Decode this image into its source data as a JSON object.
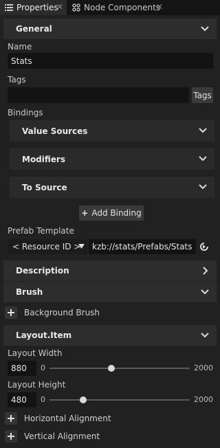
{
  "tabs": [
    {
      "label": "Properties",
      "active": true
    },
    {
      "label": "Node Components",
      "active": false
    }
  ],
  "general": {
    "title": "General",
    "name_label": "Name",
    "name_value": "Stats",
    "tags_label": "Tags",
    "tags_value": "",
    "tags_button": "Tags",
    "bindings_label": "Bindings",
    "bindings": [
      {
        "label": "Value Sources"
      },
      {
        "label": "Modifiers"
      },
      {
        "label": "To Source"
      }
    ],
    "add_binding": "Add Binding",
    "prefab_label": "Prefab Template",
    "resource_select": "< Resource ID >",
    "prefab_value": "kzb://stats/Prefabs/Stats"
  },
  "description": {
    "title": "Description"
  },
  "brush": {
    "title": "Brush",
    "background_brush": "Background Brush"
  },
  "layout_item": {
    "title": "Layout.Item",
    "width_label": "Layout Width",
    "width_value": "880",
    "width_min": "0",
    "width_max": "2000",
    "height_label": "Layout Height",
    "height_value": "480",
    "height_min": "0",
    "height_max": "2000",
    "horizontal_alignment": "Horizontal Alignment",
    "vertical_alignment": "Vertical Alignment"
  },
  "icons": {
    "properties_tab": "list-icon",
    "node_components_tab": "components-icon",
    "close": "close-icon",
    "expand": "chevron-down-icon",
    "collapsed": "chevron-right-icon",
    "add": "plus-icon",
    "go": "navigate-arrow-icon",
    "dropdown": "triangle-down-icon"
  },
  "colors": {
    "background": "#1a1a1a",
    "panel": "#212121",
    "section_header": "#2d2d2d",
    "input": "#131313",
    "text": "#d6d6d6"
  }
}
